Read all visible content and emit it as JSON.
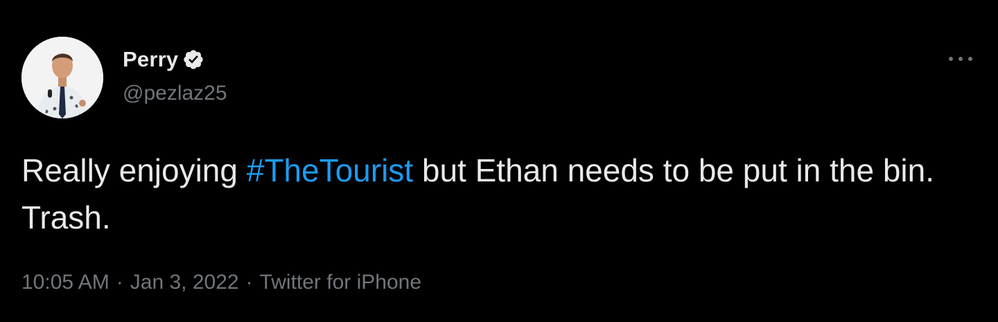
{
  "author": {
    "display_name": "Perry",
    "handle": "@pezlaz25",
    "verified": true,
    "verified_icon": "verified-badge-icon"
  },
  "menu": {
    "icon": "more-dots-icon",
    "label": "···"
  },
  "tweet": {
    "text_before": "Really enjoying ",
    "hashtag": "#TheTourist",
    "text_after": " but Ethan needs to be put in the bin. Trash."
  },
  "meta": {
    "time": "10:05 AM",
    "separator": "·",
    "date": "Jan 3, 2022",
    "source": "Twitter for iPhone"
  },
  "colors": {
    "background": "#000000",
    "primary_text": "#e7e9ea",
    "secondary_text": "#71767b",
    "link": "#1d9bf0"
  }
}
